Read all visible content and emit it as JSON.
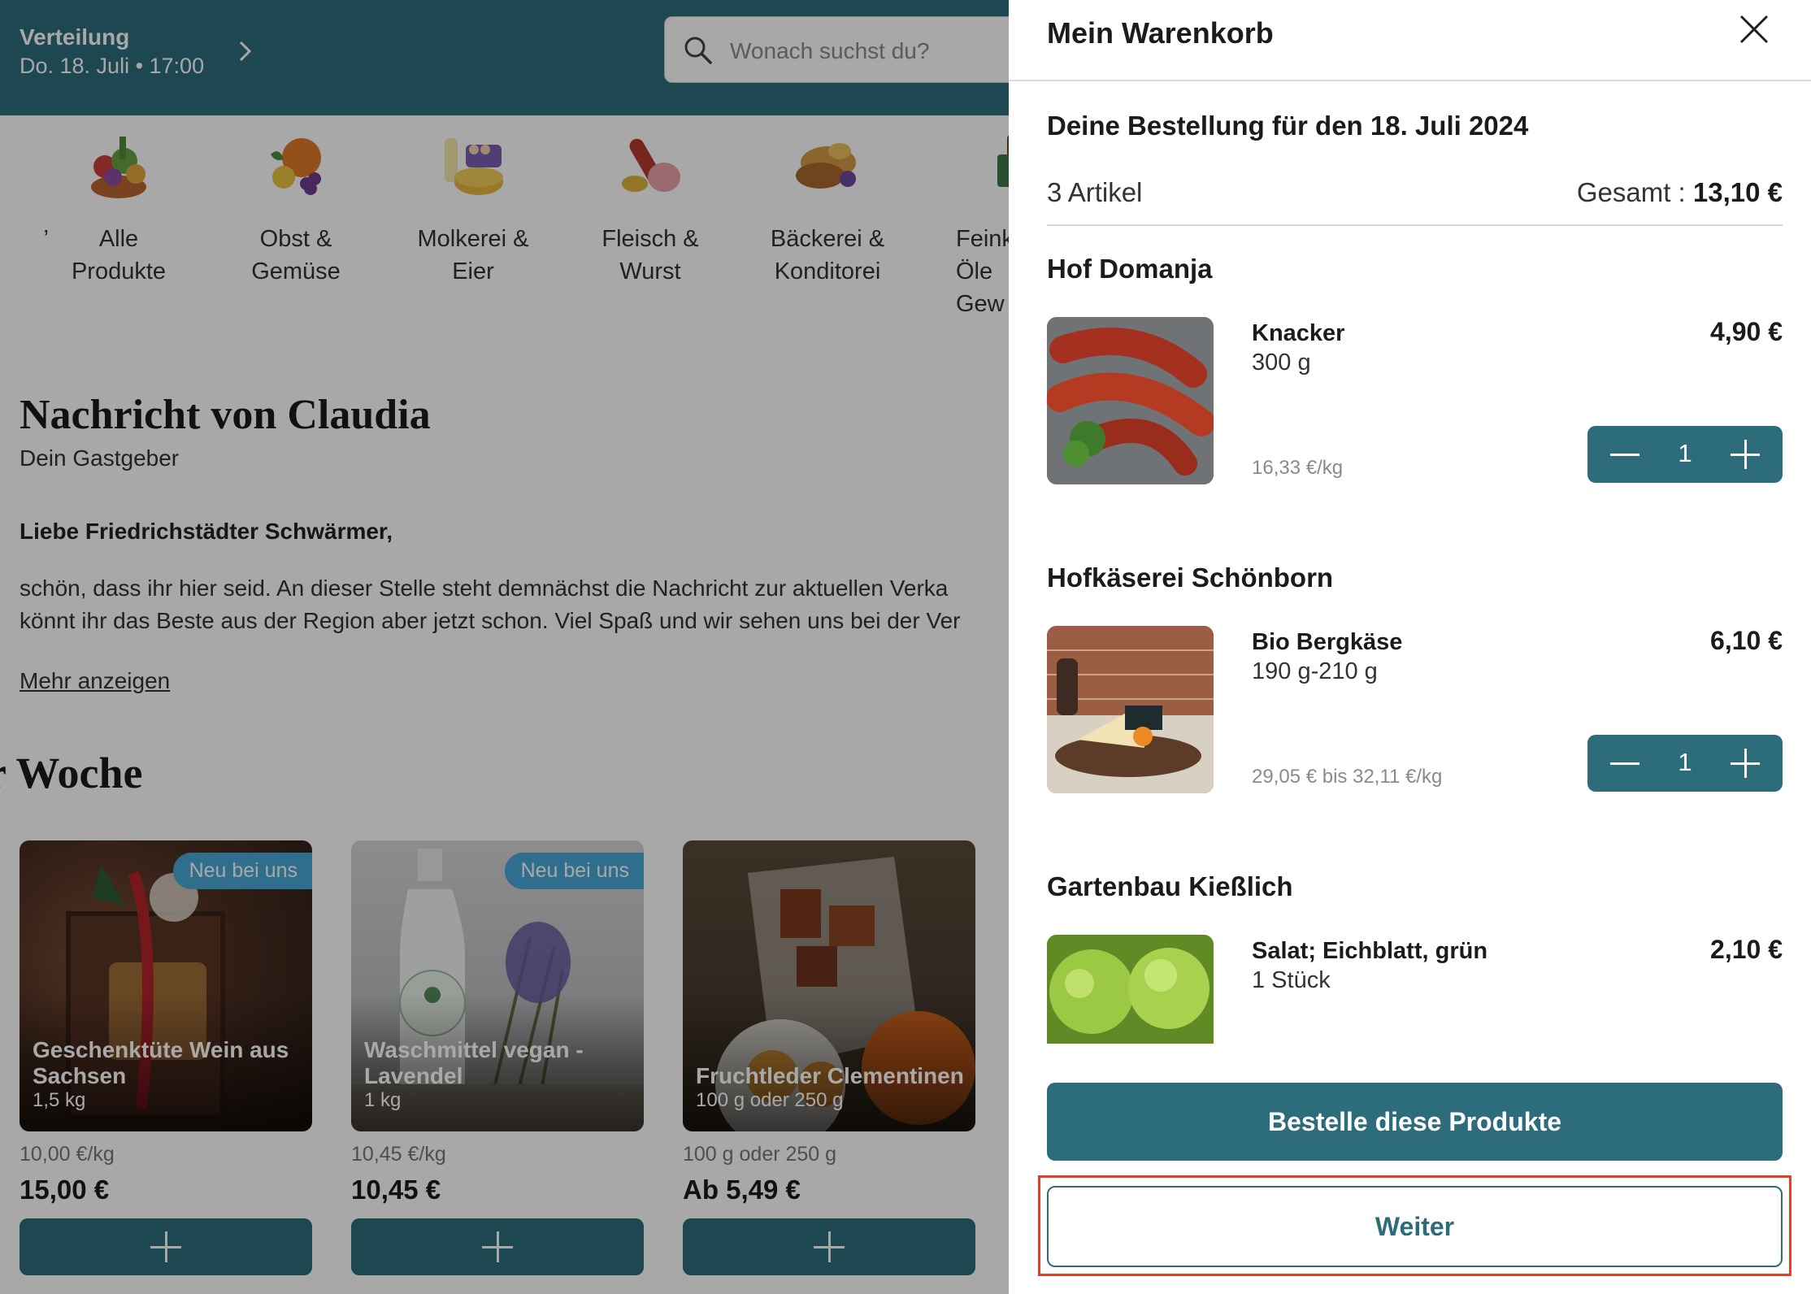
{
  "header": {
    "distribution_label": "Verteilung",
    "distribution_datetime": "Do. 18. Juli • 17:00",
    "search_placeholder": "Wonach suchst du?"
  },
  "categories": [
    {
      "label": "Alle\nProdukte",
      "icon": "all-products-icon"
    },
    {
      "label": "Obst &\nGemüse",
      "icon": "fruit-vegetables-icon"
    },
    {
      "label": "Molkerei &\nEier",
      "icon": "dairy-eggs-icon"
    },
    {
      "label": "Fleisch &\nWurst",
      "icon": "meat-sausage-icon"
    },
    {
      "label": "Bäckerei &\nKonditorei",
      "icon": "bakery-icon"
    },
    {
      "label": "Feink\nÖle\nGew",
      "icon": "delicatessen-icon"
    }
  ],
  "message": {
    "title": "Nachricht von Claudia",
    "subtitle": "Dein Gastgeber",
    "greeting": "Liebe Friedrichstädter Schwärmer,",
    "body_line1": "schön, dass ihr hier seid. An dieser Stelle steht demnächst die Nachricht zur aktuellen Verka",
    "body_line2": "könnt ihr das Beste aus der Region aber jetzt schon. Viel Spaß und wir sehen uns bei der Ver",
    "more_link": "Mehr anzeigen"
  },
  "week_section": {
    "title": "r Woche"
  },
  "products": [
    {
      "badge": "Neu bei uns",
      "name": "Geschenktüte Wein aus Sachsen",
      "qty": "1,5 kg",
      "unit_price": "10,00 €/kg",
      "price": "15,00 €"
    },
    {
      "badge": "Neu bei uns",
      "name": "Waschmittel vegan - Lavendel",
      "qty": "1 kg",
      "unit_price": "10,45 €/kg",
      "price": "10,45 €"
    },
    {
      "badge": "",
      "name": "Fruchtleder Clementinen",
      "qty": "100 g oder 250 g",
      "unit_price": "100 g oder 250 g",
      "price": "Ab 5,49 €"
    }
  ],
  "cart": {
    "title": "Mein Warenkorb",
    "order_date": "Deine Bestellung für den 18. Juli 2024",
    "item_count": "3 Artikel",
    "total_label": "Gesamt :",
    "total_value": "13,10 €",
    "vendors": [
      {
        "name": "Hof Domanja",
        "item": {
          "name": "Knacker",
          "qty": "300 g",
          "unit_price": "16,33 €/kg",
          "price": "4,90 €",
          "count": "1"
        }
      },
      {
        "name": "Hofkäserei Schönborn",
        "item": {
          "name": "Bio Bergkäse",
          "qty": "190 g-210 g",
          "unit_price": "29,05 € bis 32,11 €/kg",
          "price": "6,10 €",
          "count": "1"
        }
      },
      {
        "name": "Gartenbau Kießlich",
        "item": {
          "name": "Salat; Eichblatt, grün",
          "qty": "1 Stück",
          "unit_price": "",
          "price": "2,10 €",
          "count": ""
        }
      }
    ],
    "order_button": "Bestelle diese Produkte",
    "continue_button": "Weiter"
  },
  "colors": {
    "brand_teal": "#2d6c7b",
    "badge_blue": "#4aa7d8",
    "highlight_red": "#e0412b"
  }
}
